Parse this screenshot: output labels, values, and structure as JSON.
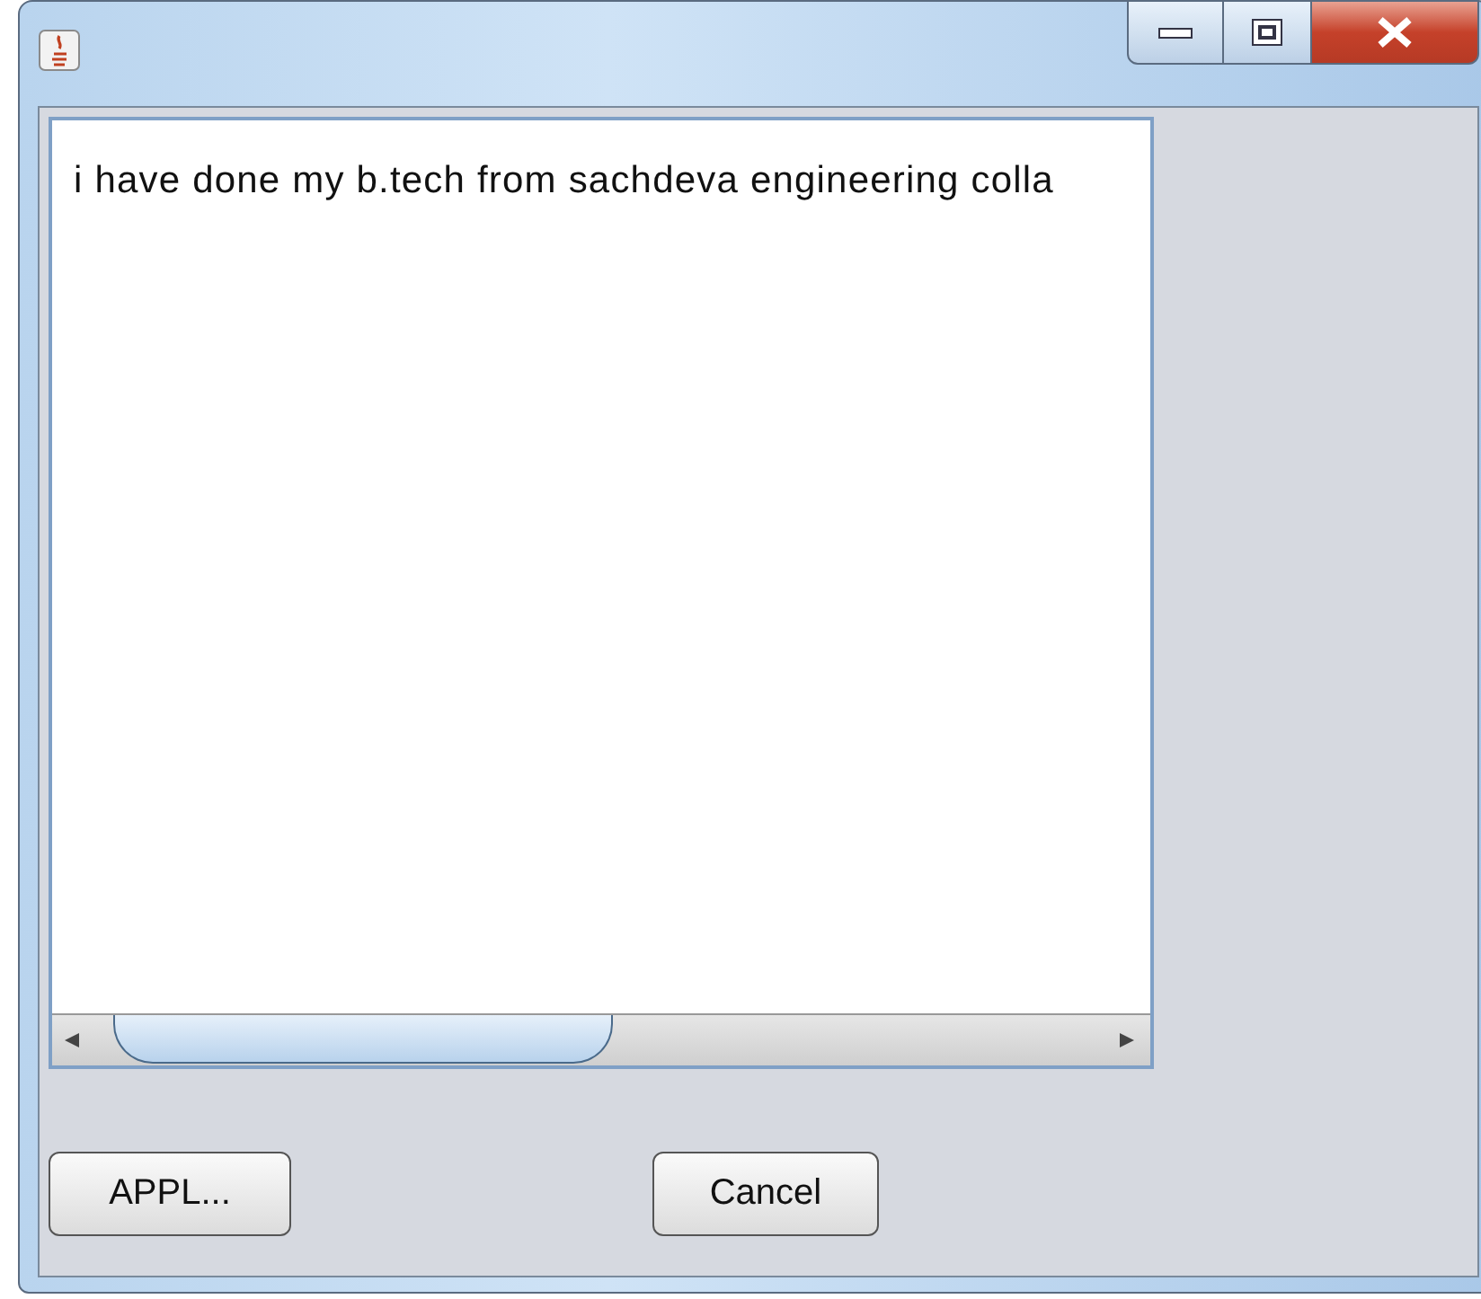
{
  "text_area": {
    "value": "i have done my b.tech from sachdeva engineering colla"
  },
  "buttons": [
    {
      "label": "APPL..."
    },
    {
      "label": "Cancel"
    }
  ]
}
